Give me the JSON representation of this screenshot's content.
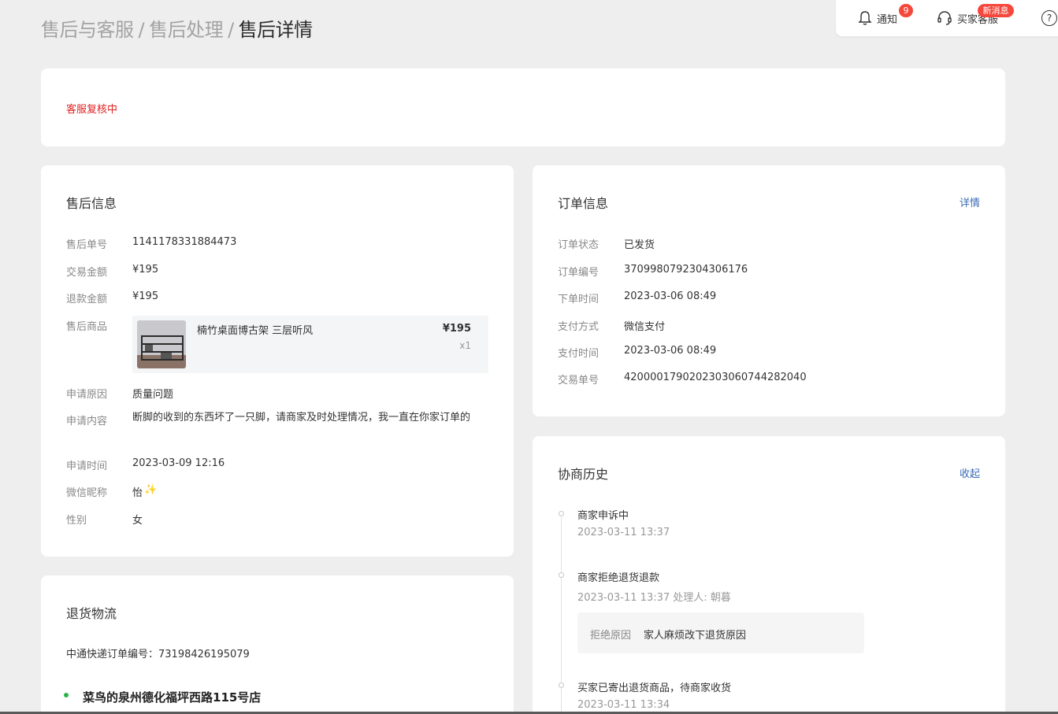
{
  "breadcrumb": {
    "items": [
      "售后与客服",
      "售后处理"
    ],
    "separator": "/",
    "current": "售后详情"
  },
  "topbar": {
    "notify": {
      "label": "通知",
      "count": "9",
      "icon": "bell-icon"
    },
    "service": {
      "label": "买家客服",
      "badge": "新消息",
      "icon": "headset-icon"
    },
    "help": {
      "icon": "help-icon",
      "glyph": "?"
    }
  },
  "status": {
    "text": "客服复核中",
    "color": "#e02020"
  },
  "aftersale": {
    "title": "售后信息",
    "id": {
      "label": "售后单号",
      "value": "1141178331884473"
    },
    "amount": {
      "label": "交易金额",
      "value": "¥195"
    },
    "refund": {
      "label": "退款金额",
      "value": "¥195"
    },
    "goods": {
      "label": "售后商品",
      "name": "楠竹桌面博古架 三层听风",
      "price": "¥195",
      "qty": "x1"
    },
    "reason": {
      "label": "申请原因",
      "value": "质量问题"
    },
    "content": {
      "label": "申请内容",
      "value": "断脚的收到的东西坏了一只脚，请商家及时处理情况，我一直在你家订单的"
    },
    "time": {
      "label": "申请时间",
      "value": "2023-03-09 12:16"
    },
    "nickname": {
      "label": "微信昵称",
      "value": "怡",
      "emoji": "✨"
    },
    "gender": {
      "label": "性别",
      "value": "女"
    }
  },
  "order": {
    "title": "订单信息",
    "link": "详情",
    "rows": [
      {
        "label": "订单状态",
        "value": "已发货"
      },
      {
        "label": "订单编号",
        "value": "3709980792304306176"
      },
      {
        "label": "下单时间",
        "value": "2023-03-06 08:49"
      },
      {
        "label": "支付方式",
        "value": "微信支付"
      },
      {
        "label": "支付时间",
        "value": "2023-03-06 08:49"
      },
      {
        "label": "交易单号",
        "value": "4200001790202303060744282040"
      }
    ]
  },
  "history": {
    "title": "协商历史",
    "link": "收起",
    "events": [
      {
        "title": "商家申诉中",
        "time": "2023-03-11 13:37"
      },
      {
        "title": "商家拒绝退货退款",
        "time": "2023-03-11 13:37 处理人: 朝暮",
        "reject_label": "拒绝原因",
        "reject_reason": "家人麻烦改下退货原因"
      },
      {
        "title": "买家已寄出退货商品，待商家收货",
        "time": "2023-03-11 13:34"
      }
    ]
  },
  "logistics": {
    "title": "退货物流",
    "tracking": "中通快递订单编号：73198426195079",
    "station": "菜鸟的泉州德化福坪西路115号店",
    "dot_color": "#2bb34a"
  }
}
